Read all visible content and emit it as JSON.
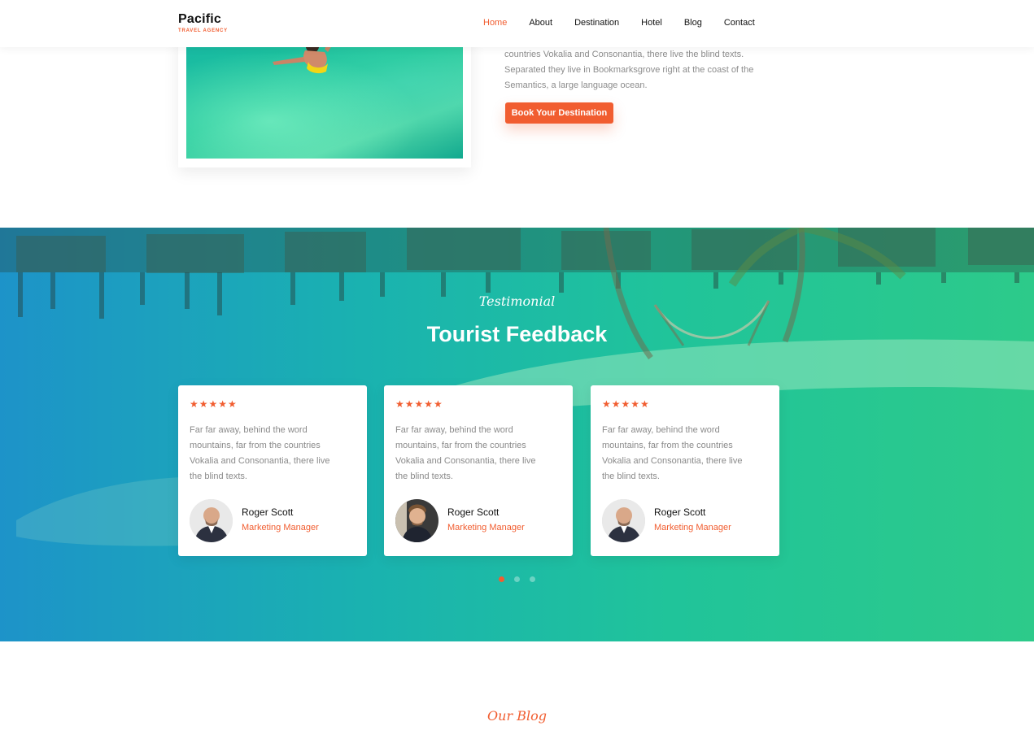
{
  "brand": {
    "name": "Pacific",
    "tagline": "TRAVEL AGENCY"
  },
  "nav": {
    "items": [
      {
        "label": "Home",
        "active": true
      },
      {
        "label": "About",
        "active": false
      },
      {
        "label": "Destination",
        "active": false
      },
      {
        "label": "Hotel",
        "active": false
      },
      {
        "label": "Blog",
        "active": false
      },
      {
        "label": "Contact",
        "active": false
      }
    ]
  },
  "about": {
    "lines": [
      "countries Vokalia and Consonantia, there live the blind texts.",
      "Separated they live in Bookmarksgrove right at the coast of the",
      "Semantics, a large language ocean."
    ],
    "cta_label": "Book Your Destination"
  },
  "testimonial": {
    "subtitle": "Testimonial",
    "title": "Tourist Feedback",
    "stars": "★★★★★",
    "cards": [
      {
        "quote_lines": [
          "Far far away, behind the word",
          "mountains, far from the countries",
          "Vokalia and Consonantia, there live",
          "the blind texts."
        ],
        "name": "Roger Scott",
        "role": "Marketing Manager",
        "avatar": "bald-man-avatar"
      },
      {
        "quote_lines": [
          "Far far away, behind the word",
          "mountains, far from the countries",
          "Vokalia and Consonantia, there live",
          "the blind texts."
        ],
        "name": "Roger Scott",
        "role": "Marketing Manager",
        "avatar": "smiling-man-avatar"
      },
      {
        "quote_lines": [
          "Far far away, behind the word",
          "mountains, far from the countries",
          "Vokalia and Consonantia, there live",
          "the blind texts."
        ],
        "name": "Roger Scott",
        "role": "Marketing Manager",
        "avatar": "bald-man-avatar"
      }
    ],
    "carousel": {
      "pages": 3,
      "active": 1
    }
  },
  "blog": {
    "subtitle": "Our Blog"
  },
  "colors": {
    "accent": "#f15d30",
    "text": "#111111",
    "muted": "#8a8a8a"
  }
}
